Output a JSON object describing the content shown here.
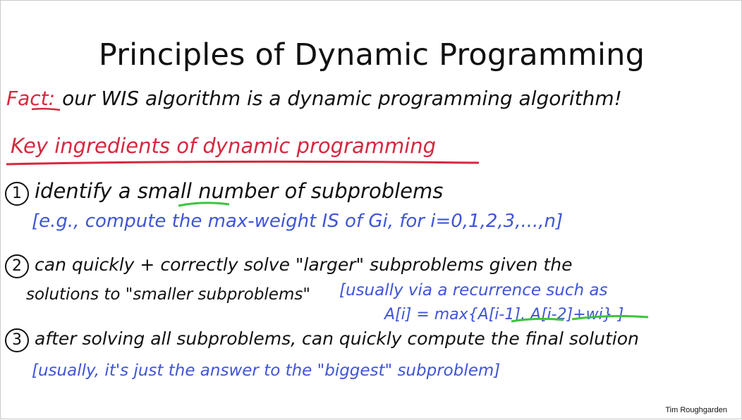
{
  "slide": {
    "title": "Principles of Dynamic Programming",
    "fact_label": "Fact",
    "fact_colon": ":",
    "fact_text": "our WIS algorithm is a dynamic programming algorithm!",
    "heading": "Key ingredients of dynamic programming",
    "points": [
      {
        "number": "1",
        "text": "identify a small number of subproblems",
        "note": "[e.g., compute the max-weight IS of Gi, for i=0,1,2,3,...,n]"
      },
      {
        "number": "2",
        "text": "can quickly + correctly solve \"larger\" subproblems given the",
        "text2": "solutions to \"smaller subproblems\"",
        "note": "[usually via a recurrence such as",
        "note2": "A[i] = max{A[i-1], A[i-2]+wi}   ]"
      },
      {
        "number": "3",
        "text": "after solving all subproblems, can quickly compute the final solution",
        "note": "[usually, it's just the answer to the \"biggest\" subproblem]"
      }
    ],
    "credit": "Tim Roughgarden"
  },
  "colors": {
    "red_ink": "#d6283f",
    "blue_ink": "#3f55d6",
    "green_ink": "#3cc43c",
    "black_ink": "#111111"
  }
}
